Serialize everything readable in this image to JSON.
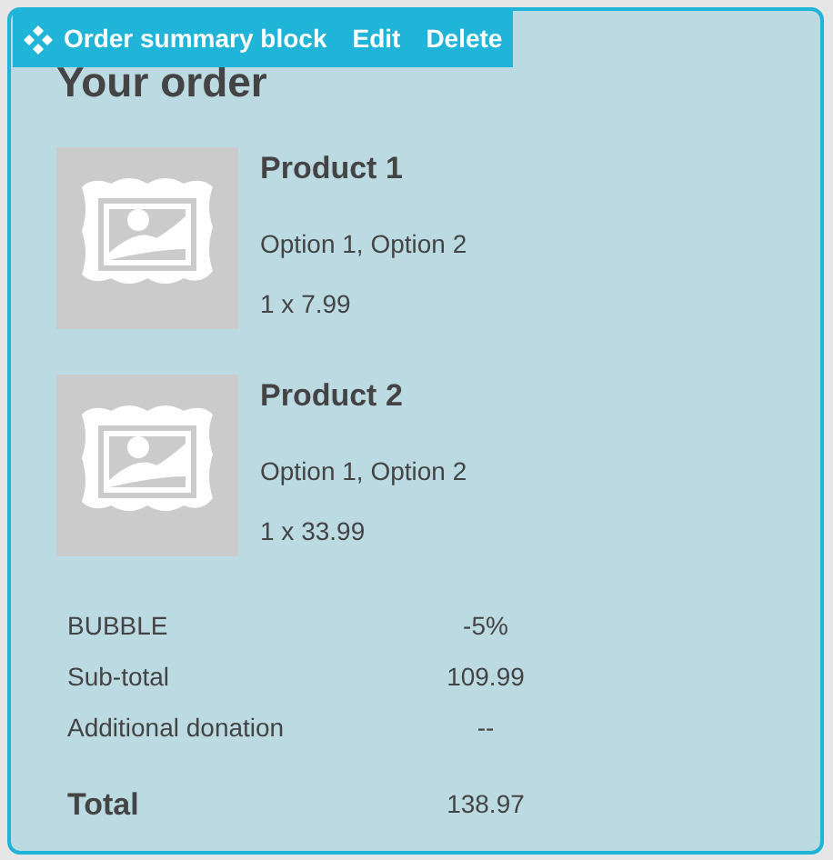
{
  "toolbar": {
    "label": "Order summary block",
    "actions": [
      "Edit",
      "Delete"
    ]
  },
  "title": "Your order",
  "products": [
    {
      "name": "Product 1",
      "options": "Option 1, Option 2",
      "quantity_price": "1 x 7.99"
    },
    {
      "name": "Product 2",
      "options": "Option 1, Option 2",
      "quantity_price": "1 x 33.99"
    }
  ],
  "summary": [
    {
      "kind": "line",
      "label": "BUBBLE",
      "value": "-5%"
    },
    {
      "kind": "line",
      "label": "Sub-total",
      "value": "109.99"
    },
    {
      "kind": "line",
      "label": "Additional donation",
      "value": "--"
    },
    {
      "kind": "total",
      "label": "Total",
      "value": "138.97"
    }
  ]
}
